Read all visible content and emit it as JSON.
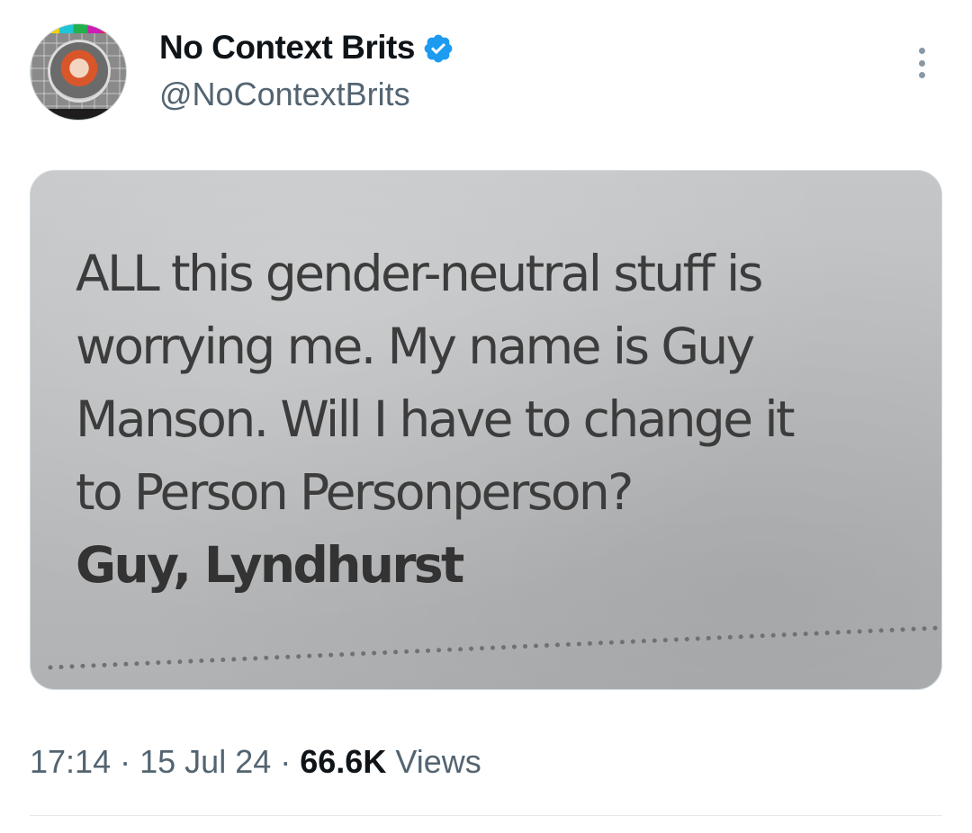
{
  "tweet": {
    "display_name": "No Context Brits",
    "handle": "@NoContextBrits",
    "verified": true,
    "more_icon": "more-horizontal-icon",
    "verified_icon": "verified-badge-icon",
    "accent_color": "#1d9bf0",
    "image": {
      "letter_body": "ALL this gender-neutral stuff is\nworrying me. My name is Guy\nManson. Will I have to change it\nto Person Personperson?",
      "signature": "Guy, Lyndhurst"
    },
    "time": "17:14",
    "separator": "·",
    "date": "15 Jul 24",
    "views_count": "66.6K",
    "views_label": "Views"
  }
}
